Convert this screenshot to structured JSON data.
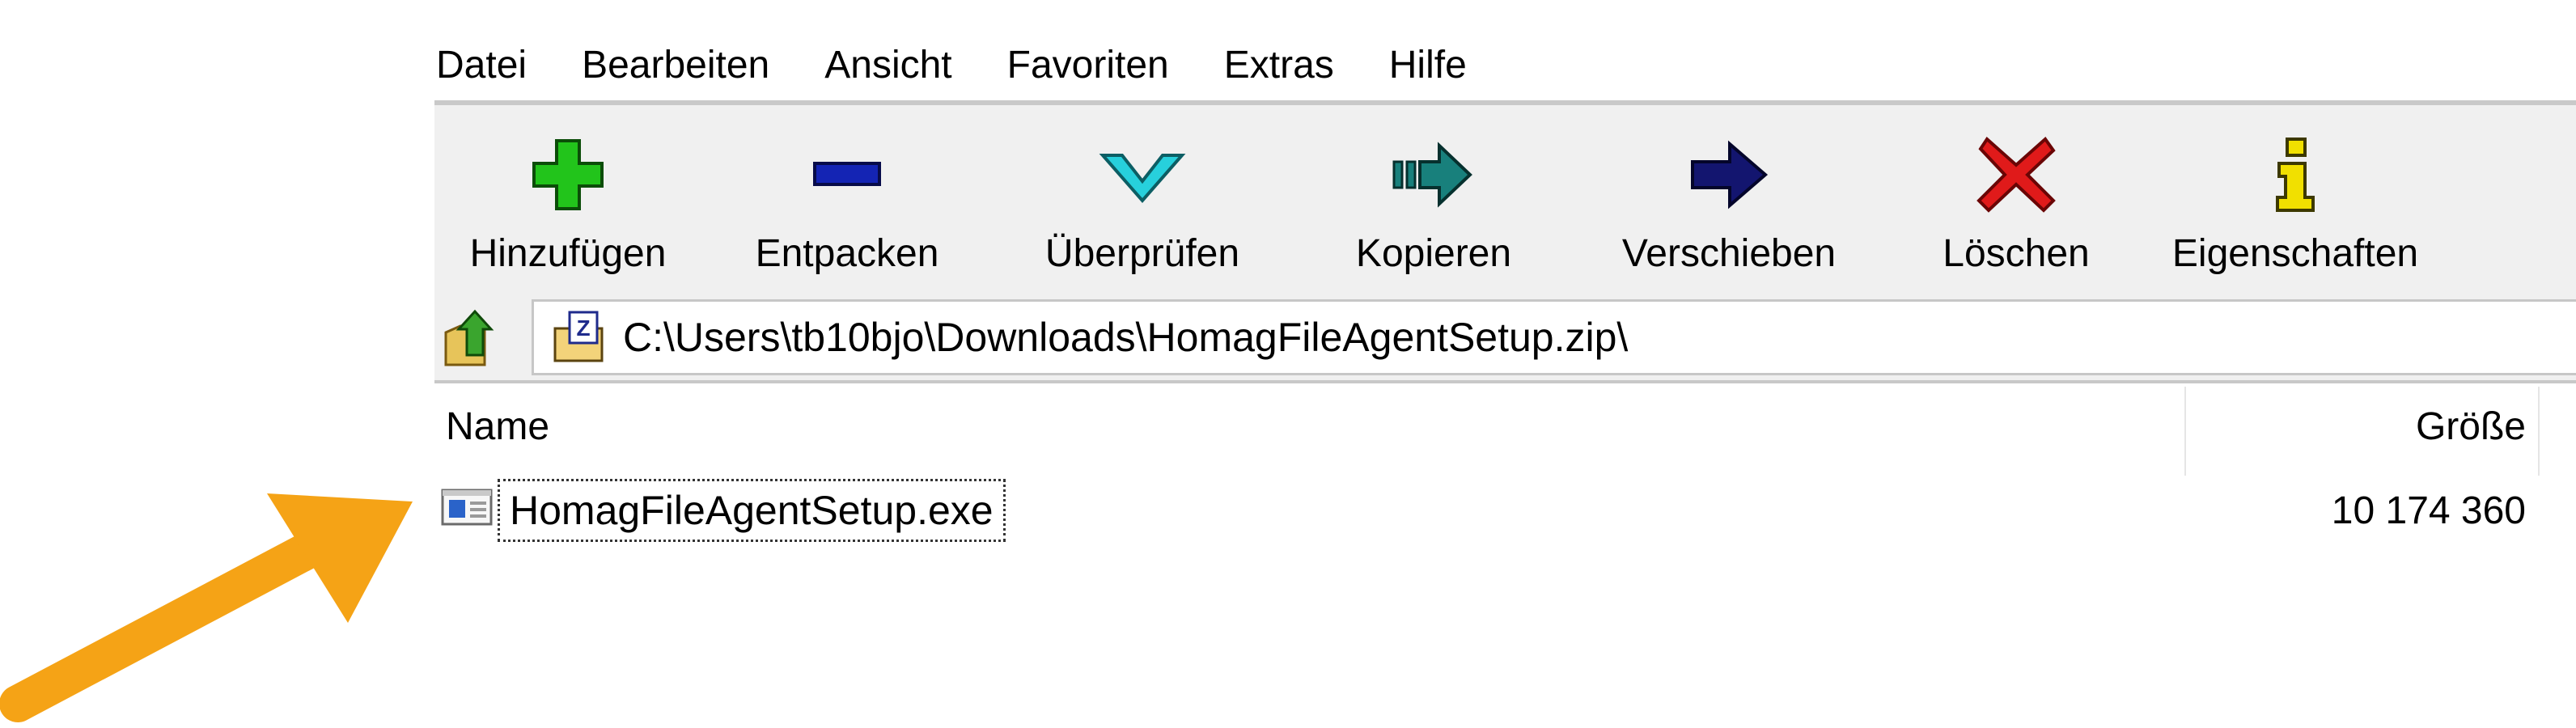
{
  "menu": [
    "Datei",
    "Bearbeiten",
    "Ansicht",
    "Favoriten",
    "Extras",
    "Hilfe"
  ],
  "toolbar": {
    "buttons": [
      {
        "label": "Hinzufügen",
        "icon": "add-icon"
      },
      {
        "label": "Entpacken",
        "icon": "extract-icon"
      },
      {
        "label": "Überprüfen",
        "icon": "test-icon"
      },
      {
        "label": "Kopieren",
        "icon": "copy-icon"
      },
      {
        "label": "Verschieben",
        "icon": "move-icon"
      },
      {
        "label": "Löschen",
        "icon": "delete-icon"
      },
      {
        "label": "Eigenschaften",
        "icon": "info-icon"
      }
    ]
  },
  "address": {
    "path": "C:\\Users\\tb10bjo\\Downloads\\HomagFileAgentSetup.zip\\"
  },
  "list": {
    "columns": {
      "name": "Name",
      "size": "Größe"
    },
    "rows": [
      {
        "name": "HomagFileAgentSetup.exe",
        "size": "10 174 360"
      }
    ]
  },
  "colors": {
    "add": "#22c41b",
    "extract": "#1424b4",
    "test": "#27d0dc",
    "copy": "#18807c",
    "move": "#13156f",
    "delete": "#e01a1a",
    "info": "#f1e000",
    "annotation_arrow": "#f5a316"
  }
}
